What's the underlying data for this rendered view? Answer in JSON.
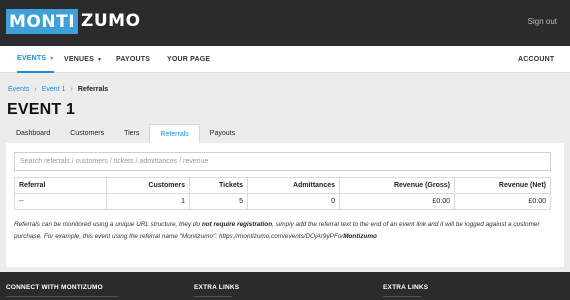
{
  "header": {
    "logo_part1": "MONTI",
    "logo_part2": "ZUMO",
    "sign_out": "Sign out"
  },
  "nav": {
    "items": [
      {
        "label": "EVENTS",
        "has_caret": true,
        "active": true
      },
      {
        "label": "VENUES",
        "has_caret": true,
        "active": false
      },
      {
        "label": "PAYOUTS",
        "has_caret": false,
        "active": false
      },
      {
        "label": "YOUR PAGE",
        "has_caret": false,
        "active": false
      }
    ],
    "account": "ACCOUNT",
    "caret_icon": "▼"
  },
  "breadcrumb": {
    "items": [
      "Events",
      "Event 1",
      "Referrals"
    ],
    "separator": "›"
  },
  "page": {
    "title": "EVENT 1"
  },
  "tabs": {
    "items": [
      "Dashboard",
      "Customers",
      "Tiers",
      "Referrals",
      "Payouts"
    ],
    "active": "Referrals"
  },
  "search": {
    "placeholder": "Search referrals / customers / tickets / admittances / revenue"
  },
  "table": {
    "headers": [
      "Referral",
      "Customers",
      "Tickets",
      "Admittances",
      "Revenue (Gross)",
      "Revenue (Net)"
    ],
    "rows": [
      [
        "--",
        "1",
        "5",
        "0",
        "£0.00",
        "£0.00"
      ]
    ]
  },
  "note": {
    "part1": "Referrals can be monitored using a unique URL structure, they do ",
    "bold1": "not require registration",
    "part2": ", simply add the referral text to the end of an event link and it will be logged against a customer purchase. For example, this event using the referral name \"Montizumo\": https://montizumo.com/events/DOjAr9yPFo/",
    "bold2": "Montizumo"
  },
  "footer": {
    "headings": [
      "CONNECT WITH MONTIZUMO",
      "EXTRA LINKS",
      "EXTRA LINKS"
    ]
  },
  "colors": {
    "accent": "#1d8fd0",
    "logo_blue": "#3da0d8",
    "dark_bar": "#2b2b2b",
    "page_bg": "#ececec"
  }
}
